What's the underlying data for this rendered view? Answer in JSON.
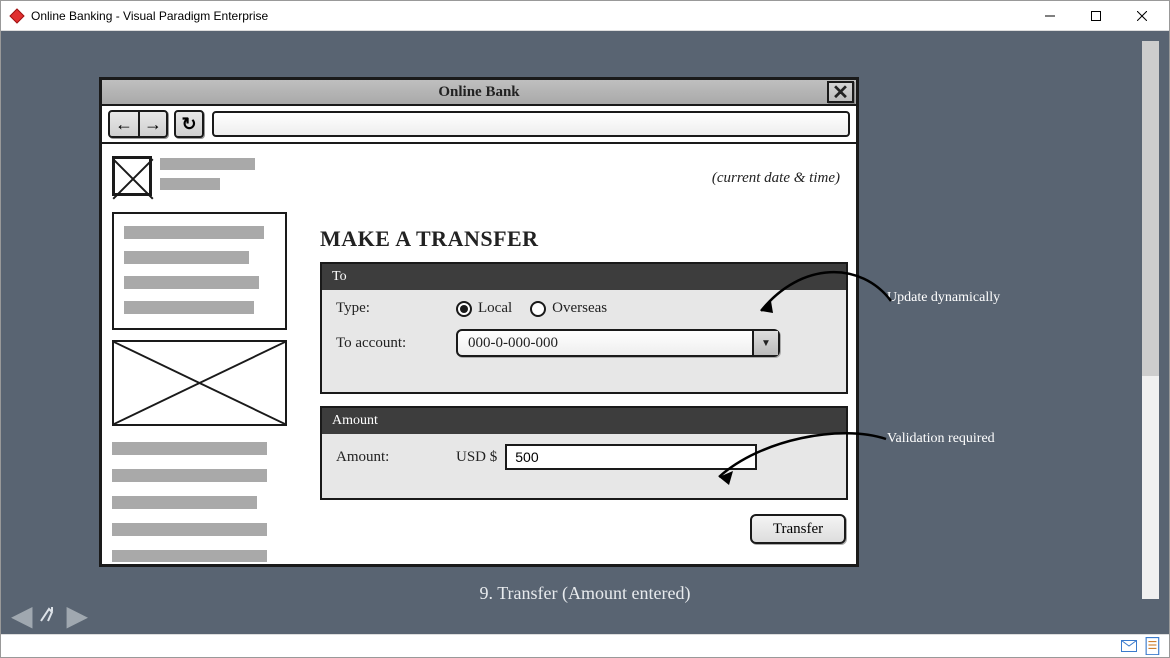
{
  "window": {
    "title": "Online Banking - Visual Paradigm Enterprise"
  },
  "wireframe": {
    "title": "Online Bank",
    "date_time_label": "(current date & time)",
    "heading": "MAKE A TRANSFER",
    "to_panel": {
      "title": "To",
      "type_label": "Type:",
      "opt_local": "Local",
      "opt_overseas": "Overseas",
      "account_label": "To account:",
      "account_value": "000-0-000-000"
    },
    "amount_panel": {
      "title": "Amount",
      "amount_label": "Amount:",
      "currency": "USD $",
      "value": "500"
    },
    "transfer_button": "Transfer"
  },
  "annotations": {
    "update_dynamic": "Update dynamically",
    "validation_required": "Validation required"
  },
  "caption": "9. Transfer (Amount entered)"
}
